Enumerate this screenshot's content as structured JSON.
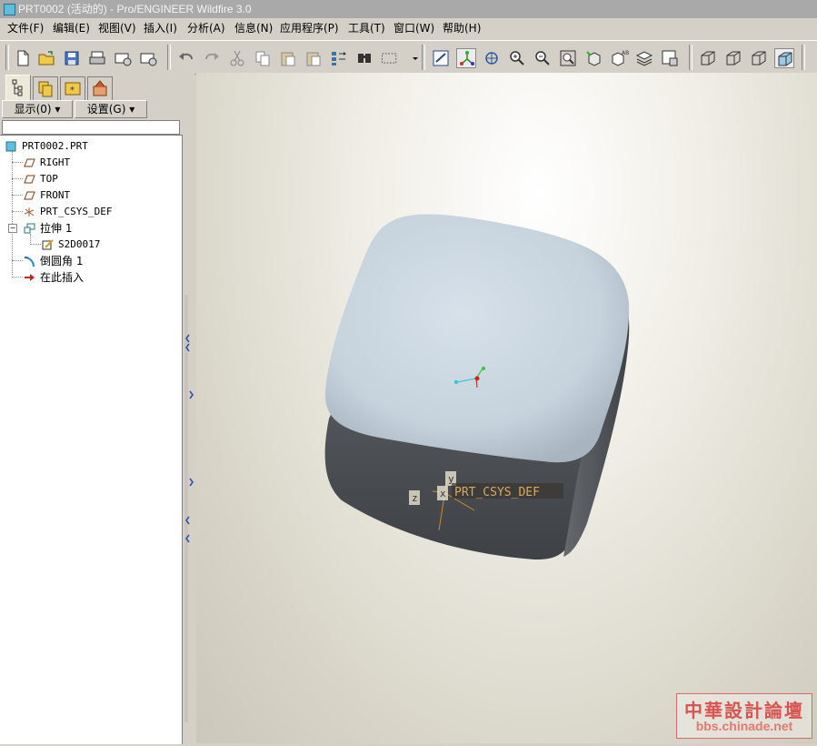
{
  "window": {
    "title": "PRT0002 (活动的) - Pro/ENGINEER Wildfire 3.0"
  },
  "menu": [
    {
      "label": "文件(F)"
    },
    {
      "label": "编辑(E)"
    },
    {
      "label": "视图(V)"
    },
    {
      "label": "插入(I)"
    },
    {
      "label": "分析(A)"
    },
    {
      "label": "信息(N)"
    },
    {
      "label": "应用程序(P)"
    },
    {
      "label": "工具(T)"
    },
    {
      "label": "窗口(W)"
    },
    {
      "label": "帮助(H)"
    }
  ],
  "toolbar": {
    "icons": [
      "new-file-icon",
      "open-folder-icon",
      "save-icon",
      "print-icon",
      "email-icon",
      "email-link-icon",
      "undo-icon",
      "redo-icon",
      "cut-icon",
      "copy-icon",
      "paste-icon",
      "paste-special-icon",
      "regenerate-icon",
      "find-icon",
      "selection-box-icon",
      "repaint-icon",
      "spin-center-icon",
      "orient-mode-icon",
      "zoom-in-icon",
      "zoom-out-icon",
      "refit-icon",
      "reorient-icon",
      "saved-views-icon",
      "layers-icon",
      "view-manager-icon",
      "wireframe-icon",
      "hidden-line-icon",
      "no-hidden-icon",
      "shading-icon"
    ]
  },
  "panel": {
    "tabs": [
      "model-tree-tab",
      "folder-browser-tab",
      "favorites-tab",
      "connections-tab"
    ],
    "show_label": "显示(0) ▾",
    "settings_label": "设置(G) ▾"
  },
  "tree": {
    "root": "PRT0002.PRT",
    "items": [
      {
        "label": "RIGHT",
        "icon": "datum-plane-icon"
      },
      {
        "label": "TOP",
        "icon": "datum-plane-icon"
      },
      {
        "label": "FRONT",
        "icon": "datum-plane-icon"
      },
      {
        "label": "PRT_CSYS_DEF",
        "icon": "csys-icon"
      },
      {
        "label": "拉伸 1",
        "icon": "extrude-icon"
      },
      {
        "label": "S2D0017",
        "icon": "sketch-icon"
      },
      {
        "label": "倒圆角 1",
        "icon": "round-icon"
      },
      {
        "label": "在此插入",
        "icon": "insert-here-arrow-icon"
      }
    ]
  },
  "viewport": {
    "csys_label": "PRT_CSYS_DEF",
    "axis_x": "x",
    "axis_y": "y",
    "axis_z": "z"
  },
  "watermark": {
    "title": "中華設計論壇",
    "url": "bbs.chinade.net"
  },
  "colors": {
    "titlebar": "#a9a9a9",
    "chrome": "#d4d0c8",
    "model_top": "#c9d4de",
    "model_side": "#4a4d51"
  }
}
